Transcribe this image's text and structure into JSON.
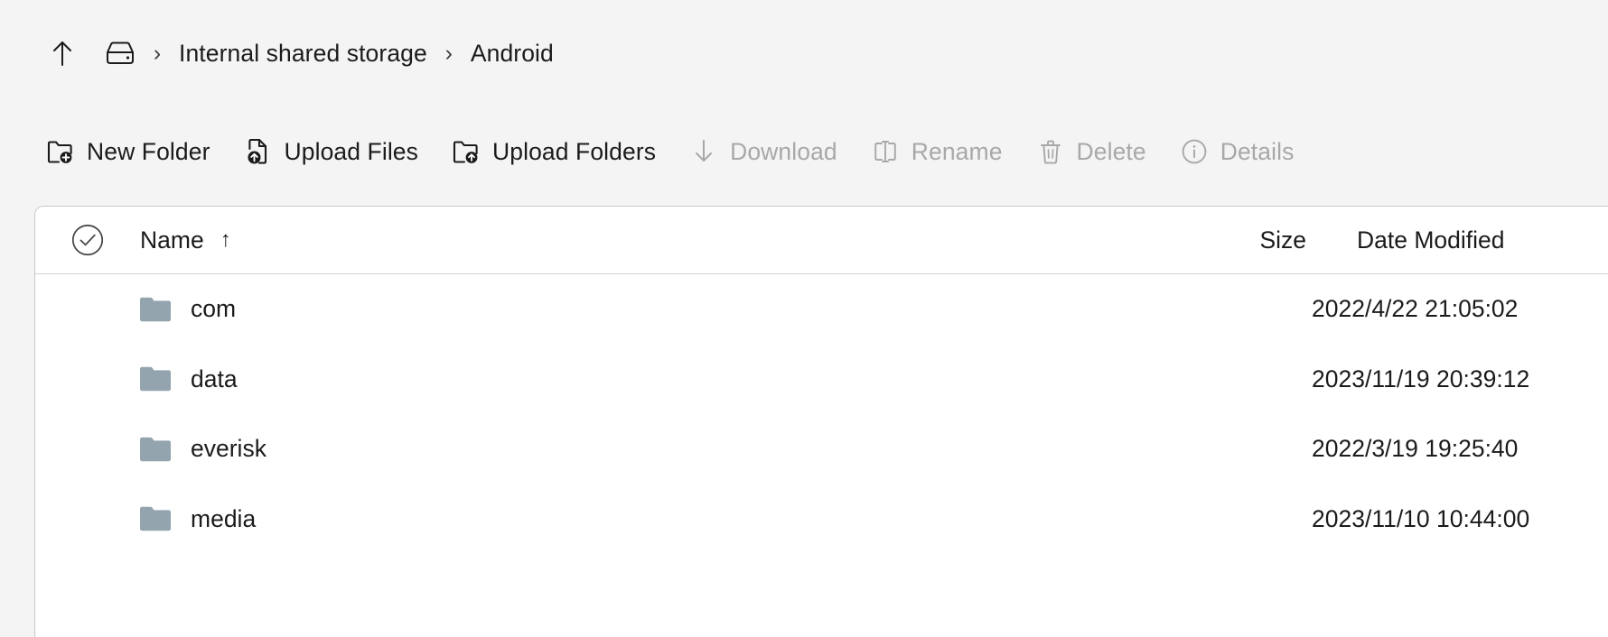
{
  "breadcrumb": {
    "up_label": "up-arrow",
    "drive_label": "internal-storage",
    "separator": "›",
    "items": [
      {
        "label": "Internal shared storage"
      },
      {
        "label": "Android"
      }
    ]
  },
  "toolbar": {
    "items": [
      {
        "label": "New Folder",
        "icon": "folder-plus-icon",
        "enabled": true
      },
      {
        "label": "Upload Files",
        "icon": "file-upload-icon",
        "enabled": true
      },
      {
        "label": "Upload Folders",
        "icon": "folder-upload-icon",
        "enabled": true
      },
      {
        "label": "Download",
        "icon": "download-icon",
        "enabled": false
      },
      {
        "label": "Rename",
        "icon": "rename-icon",
        "enabled": false
      },
      {
        "label": "Delete",
        "icon": "trash-icon",
        "enabled": false
      },
      {
        "label": "Details",
        "icon": "info-circle-icon",
        "enabled": false
      }
    ]
  },
  "table": {
    "select_all_icon": "check-circle-icon",
    "columns": {
      "name": "Name",
      "size": "Size",
      "date": "Date Modified"
    },
    "sort": {
      "column": "Name",
      "direction": "ascending",
      "arrow": "↑"
    },
    "rows": [
      {
        "name": "com",
        "size": "",
        "date": "2022/4/22 21:05:02"
      },
      {
        "name": "data",
        "size": "",
        "date": "2023/11/19 20:39:12"
      },
      {
        "name": "everisk",
        "size": "",
        "date": "2022/3/19 19:25:40"
      },
      {
        "name": "media",
        "size": "",
        "date": "2023/11/10 10:44:00"
      }
    ]
  },
  "colors": {
    "background": "#f4f4f4",
    "panel": "#ffffff",
    "text": "#1b1b1b",
    "disabled_text": "#a8a8a8",
    "folder_icon": "#93a4ae",
    "border": "#d2d2d2"
  }
}
